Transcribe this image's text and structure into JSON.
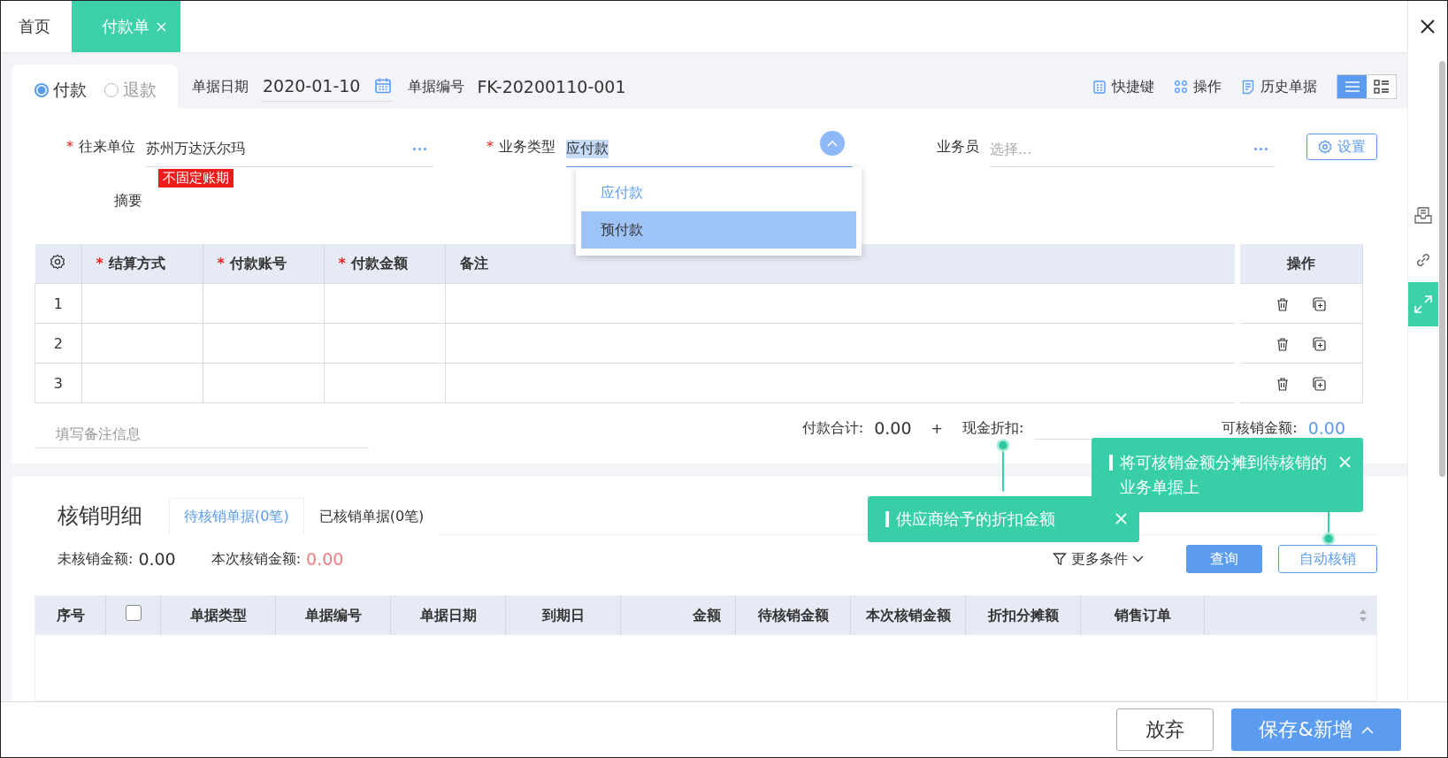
{
  "tabs": [
    {
      "label": "首页",
      "selected": false,
      "closable": false
    },
    {
      "label": "付款单",
      "selected": true,
      "closable": true
    }
  ],
  "direction": [
    {
      "label": "付款",
      "selected": true
    },
    {
      "label": "退款",
      "selected": false
    }
  ],
  "header_fields": [
    {
      "label": "单据日期",
      "value": "2020-01-10",
      "kind": "date"
    },
    {
      "label": "单据编号",
      "value": "FK-20200110-001",
      "kind": "text"
    }
  ],
  "toolbar": [
    {
      "label": "快捷键",
      "kind": "shortcuts"
    },
    {
      "label": "操作",
      "kind": "actions"
    },
    {
      "label": "历史单据",
      "kind": "history"
    }
  ],
  "view_modes": [
    {
      "kind": "list",
      "selected": true
    },
    {
      "kind": "cards",
      "selected": false
    }
  ],
  "settings_button": "设置",
  "form": {
    "partner": {
      "mark": "*",
      "label": "往来单位",
      "value": "苏州万达沃尔玛",
      "tag": "不固定账期"
    },
    "business_type": {
      "mark": "*",
      "label": "业务类型",
      "value": "应付款",
      "expanded": true,
      "options": [
        {
          "label": "应付款",
          "selected": true,
          "highlighted": false
        },
        {
          "label": "预付款",
          "selected": false,
          "highlighted": true
        }
      ]
    },
    "salesperson": {
      "label": "业务员",
      "placeholder": "选择..."
    },
    "summary": {
      "label": "摘要"
    }
  },
  "lines": {
    "columns": [
      {
        "mark": "*",
        "label": "结算方式"
      },
      {
        "mark": "*",
        "label": "付款账号"
      },
      {
        "mark": "*",
        "label": "付款金额"
      },
      {
        "label": "备注"
      }
    ],
    "action_header": "操作",
    "rows": [
      "1",
      "2",
      "3"
    ]
  },
  "remark_placeholder": "填写备注信息",
  "totals": {
    "payment_label": "付款合计:",
    "payment_value": "0.00",
    "plus": "+",
    "discount_label": "现金折扣:",
    "writeoff_label": "可核销金额:",
    "writeoff_value": "0.00"
  },
  "writeoff": {
    "title": "核销明细",
    "tabs": [
      {
        "label": "待核销单据(0笔)",
        "selected": true
      },
      {
        "label": "已核销单据(0笔)",
        "selected": false
      }
    ],
    "unsettled_label": "未核销金额:",
    "unsettled_value": "0.00",
    "current_label": "本次核销金额:",
    "current_value": "0.00",
    "filter": "更多条件",
    "buttons": [
      {
        "label": "查询",
        "kind": "primary"
      },
      {
        "label": "自动核销",
        "kind": "outline"
      }
    ],
    "columns": [
      {
        "label": "序号",
        "kind": "text"
      },
      {
        "kind": "checkbox",
        "checked": false
      },
      {
        "label": "单据类型",
        "kind": "text"
      },
      {
        "label": "单据编号",
        "kind": "text"
      },
      {
        "label": "单据日期",
        "kind": "text"
      },
      {
        "label": "到期日",
        "kind": "text"
      },
      {
        "label": "金额",
        "kind": "number"
      },
      {
        "label": "待核销金额",
        "kind": "text"
      },
      {
        "label": "本次核销金额",
        "kind": "text"
      },
      {
        "label": "折扣分摊额",
        "kind": "text"
      },
      {
        "label": "销售订单",
        "kind": "text"
      }
    ]
  },
  "tips": [
    {
      "text": "将可核销金额分摊到待核销的业务单据上"
    },
    {
      "text": "供应商给予的折扣金额"
    }
  ],
  "footer": {
    "buttons": [
      {
        "label": "放弃",
        "kind": "default"
      },
      {
        "label": "保存&新增",
        "kind": "primary"
      }
    ]
  }
}
